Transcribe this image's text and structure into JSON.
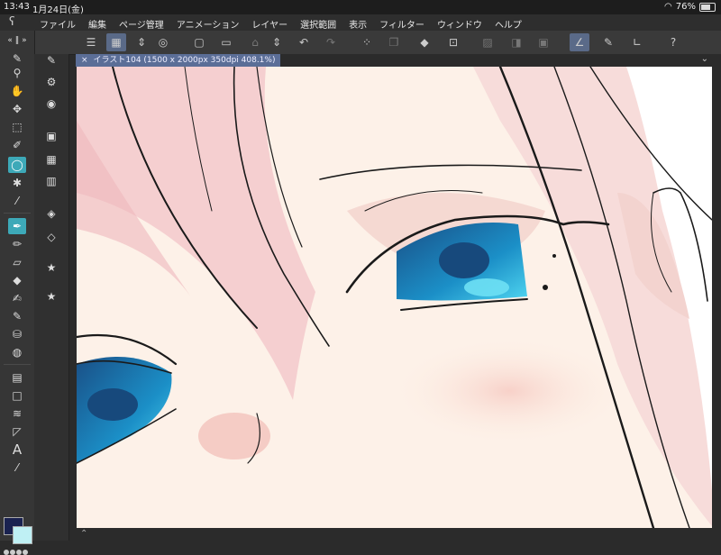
{
  "status": {
    "time": "13:43",
    "date": "1月24日(金)",
    "battery": "76%"
  },
  "menu": [
    "ファイル",
    "編集",
    "ページ管理",
    "アニメーション",
    "レイヤー",
    "選択範囲",
    "表示",
    "フィルター",
    "ウィンドウ",
    "ヘルプ"
  ],
  "document": {
    "tab_title": "イラスト104 (1500 x 2000px 350dpi 408.1%)"
  },
  "colors": {
    "main": "#1a2250",
    "sub": "#bff0f4",
    "accent": "#3da9b8"
  },
  "icons": {
    "menu": "hamburger-icon",
    "tools": [
      "zoom-icon",
      "hand-icon",
      "move-icon",
      "object-select-icon",
      "pen-select-icon",
      "lasso-icon",
      "wand-icon",
      "eyedropper-icon",
      "pen-icon",
      "pencil-icon",
      "eraser-icon",
      "fill-icon",
      "brush-icon",
      "decoration-icon",
      "blend-icon",
      "gradient-icon",
      "shape-icon",
      "ruler-icon",
      "line-icon",
      "text-icon",
      "balloon-icon"
    ]
  }
}
